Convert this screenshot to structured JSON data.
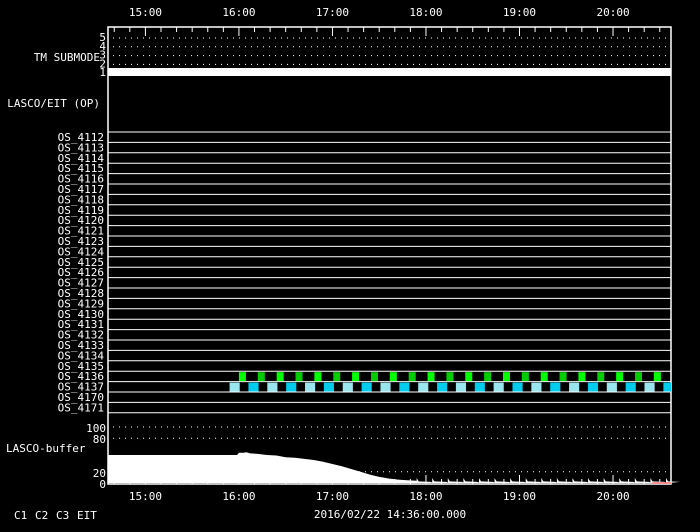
{
  "chart_data": {
    "type": "timeline",
    "title": "2016/02/22 14:36:00.000",
    "time_range_hours": [
      14.6,
      20.62
    ],
    "x_tick_labels": [
      "15:00",
      "16:00",
      "17:00",
      "18:00",
      "19:00",
      "20:00"
    ],
    "x_tick_hours": [
      15,
      16,
      17,
      18,
      19,
      20
    ],
    "tm_submode": {
      "label": "TM SUBMODE",
      "levels": [
        "5",
        "4",
        "3",
        "2",
        "1"
      ],
      "active_level": 1
    },
    "lasco_eit_label": "LASCO/EIT (OP)",
    "os_rows": [
      "OS_4112",
      "OS_4113",
      "OS_4114",
      "OS_4115",
      "OS_4116",
      "OS_4117",
      "OS_4118",
      "OS_4119",
      "OS_4120",
      "OS_4121",
      "OS_4123",
      "OS_4124",
      "OS_4125",
      "OS_4126",
      "OS_4127",
      "OS_4128",
      "OS_4129",
      "OS_4130",
      "OS_4131",
      "OS_4132",
      "OS_4133",
      "OS_4134",
      "OS_4135",
      "OS_4136",
      "OS_4137",
      "OS_4170",
      "OS_4171"
    ],
    "os_activity": [
      {
        "row": "OS_4136",
        "start_hour": 16.0,
        "interval_min": 12.1,
        "duration_min": 4.5,
        "count": 23,
        "colors": [
          "#00ff00",
          "#00cc00"
        ]
      },
      {
        "row": "OS_4137",
        "start_hour": 15.9,
        "interval_min": 12.1,
        "duration_min": 6.5,
        "count": 24,
        "colors": [
          "#99e6ee",
          "#00ccee"
        ]
      }
    ],
    "buffer": {
      "label": "LASCO-buffer",
      "y_ticks": [
        "0",
        "20",
        "80",
        "100"
      ],
      "y_tick_values": [
        0,
        20,
        80,
        100
      ],
      "ylim": [
        0,
        100
      ],
      "dotted_at": [
        20,
        80,
        100
      ],
      "series": [
        [
          14.6,
          50
        ],
        [
          15.98,
          50
        ],
        [
          16.0,
          54
        ],
        [
          16.05,
          54
        ],
        [
          16.08,
          55
        ],
        [
          16.12,
          53
        ],
        [
          16.2,
          52
        ],
        [
          16.3,
          50
        ],
        [
          16.4,
          49
        ],
        [
          16.5,
          46
        ],
        [
          16.6,
          45
        ],
        [
          16.7,
          43
        ],
        [
          16.8,
          41
        ],
        [
          16.9,
          38
        ],
        [
          17.0,
          34
        ],
        [
          17.1,
          30
        ],
        [
          17.2,
          25
        ],
        [
          17.3,
          20
        ],
        [
          17.4,
          15
        ],
        [
          17.5,
          11
        ],
        [
          17.6,
          8
        ],
        [
          17.7,
          6
        ],
        [
          17.8,
          5
        ],
        [
          17.9,
          4
        ]
      ]
    },
    "legend": [
      {
        "label": "C1",
        "color": "#ff2020"
      },
      {
        "label": "C2",
        "color": "#20e020"
      },
      {
        "label": "C3",
        "color": "#a0e8f0"
      },
      {
        "label": "EIT",
        "color": "#ffff00"
      }
    ]
  }
}
